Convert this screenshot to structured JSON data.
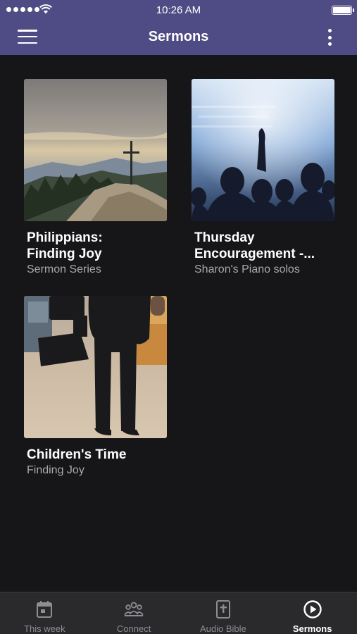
{
  "status_bar": {
    "time": "10:26 AM"
  },
  "nav": {
    "title": "Sermons"
  },
  "sermons": [
    {
      "title": "Philippians:\nFinding Joy",
      "subtitle": "Sermon Series"
    },
    {
      "title": "Thursday\nEncouragement -...",
      "subtitle": "Sharon's Piano solos"
    },
    {
      "title": "Children's Time",
      "subtitle": "Finding Joy"
    }
  ],
  "tabs": [
    {
      "label": "This week",
      "icon": "calendar-icon",
      "active": false
    },
    {
      "label": "Connect",
      "icon": "people-icon",
      "active": false
    },
    {
      "label": "Audio Bible",
      "icon": "bible-icon",
      "active": false
    },
    {
      "label": "Sermons",
      "icon": "play-circle-icon",
      "active": true
    }
  ],
  "colors": {
    "header": "#4f4b84",
    "background": "#161618",
    "tabbar": "#2a2a2d",
    "subtitle": "#a9a9ad"
  }
}
